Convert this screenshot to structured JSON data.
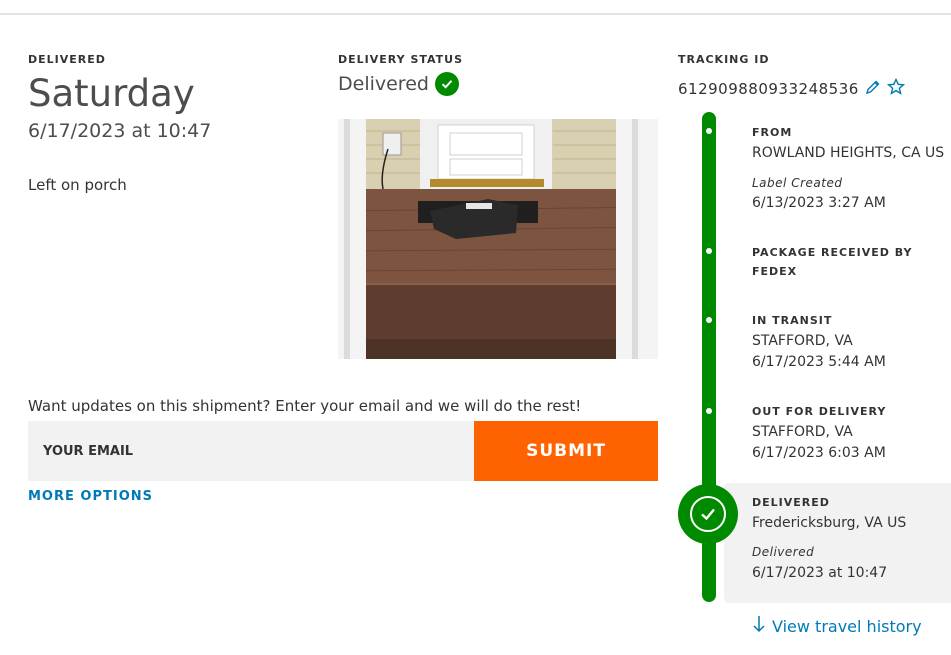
{
  "delivery": {
    "label": "DELIVERED",
    "day": "Saturday",
    "datetime": "6/17/2023 at 10:47",
    "note": "Left on porch"
  },
  "status": {
    "label": "DELIVERY STATUS",
    "value": "Delivered"
  },
  "tracking": {
    "label": "TRACKING ID",
    "id": "612909880933248536"
  },
  "email_form": {
    "prompt": "Want updates on this shipment? Enter your email and we will do the rest!",
    "placeholder": "YOUR EMAIL",
    "submit_label": "SUBMIT",
    "more_options": "MORE OPTIONS"
  },
  "timeline": {
    "from_title": "FROM",
    "from_location": "ROWLAND HEIGHTS, CA US",
    "from_status": "Label Created",
    "from_time": "6/13/2023 3:27 AM",
    "received_title_1": "PACKAGE RECEIVED BY",
    "received_title_2": "FEDEX",
    "transit_title": "IN TRANSIT",
    "transit_location": "STAFFORD, VA",
    "transit_time": "6/17/2023 5:44 AM",
    "ofd_title": "OUT FOR DELIVERY",
    "ofd_location": "STAFFORD, VA",
    "ofd_time": "6/17/2023 6:03 AM",
    "delivered_title": "DELIVERED",
    "delivered_location": "Fredericksburg, VA US",
    "delivered_status": "Delivered",
    "delivered_time": "6/17/2023 at 10:47"
  },
  "history_link": "View travel history",
  "colors": {
    "accent_orange": "#ff6200",
    "success_green": "#008a00",
    "link_blue": "#007ab7"
  },
  "icons": [
    "check-icon",
    "pencil-icon",
    "star-icon",
    "arrow-down-icon"
  ]
}
